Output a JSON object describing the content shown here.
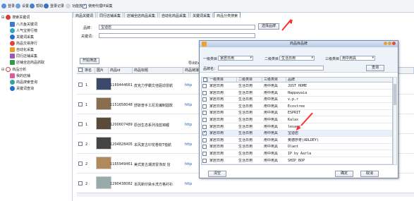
{
  "topbar": {
    "items": [
      "登录",
      "设置",
      "帮助",
      "登录记录",
      "功能放大"
    ],
    "checkbox_label": "使用代理IP采集"
  },
  "tabs": [
    "商品关键词",
    "同行店铺采集",
    "店铺全店商品采集",
    "自动化商品采集",
    "关键词采集",
    "商品分类搜索"
  ],
  "sidebar": {
    "group1": "搜索关键词",
    "items1": [
      "八爪鱼关键词",
      "人气宝排行榜",
      "关键词采集",
      "商品交易排行",
      "自动化采集",
      "同行店铺采集",
      "店铺全店商品抓取"
    ],
    "group2": "商品分析",
    "items2": [
      "我的店铺",
      "商品搜索查询",
      "关键词查询"
    ]
  },
  "form": {
    "brand_label": "品牌：",
    "brand_value": "宝迪岩",
    "keyword_label": "关键词：",
    "select_brand_button": "选择品牌",
    "start_button": "开始筛选",
    "export_button": "导出Excel"
  },
  "grid": {
    "headers": [
      "",
      "排名",
      "图片",
      "商品id",
      "商品标题",
      "商品链接",
      "商"
    ],
    "rows": [
      {
        "rank": "1",
        "id": "11694446617",
        "title": "皮克力学霸文他驱动冒航",
        "link": "http"
      },
      {
        "rank": "1",
        "id": "11516580481",
        "title": "舒斯普手工尼龙编制圆款",
        "link": "http"
      },
      {
        "rank": "1",
        "id": "12006074895",
        "title": "原创生态系列浅蓝锦鲤",
        "link": "http"
      },
      {
        "rank": "2",
        "id": "12048284051",
        "title": "本风复古印花卷软T恤航",
        "link": "http"
      },
      {
        "rank": "2",
        "id": "11659494612",
        "title": "美式复古潮流冒涤双 信",
        "link": "http"
      },
      {
        "rank": "2",
        "id": "12904380826",
        "title": "本风新印染水洗方格衬衫",
        "link": "http"
      }
    ]
  },
  "dialog": {
    "title": "商品库品牌",
    "cat1_label": "一级类目：",
    "cat1_value": "家居日用",
    "cat2_label": "二级类目：",
    "cat2_value": "生活日用",
    "cat3_label": "三级类目：",
    "cat3_value": "用中用具",
    "brand_label": "品牌名：",
    "search_button": "查询",
    "headers": [
      "",
      "一级类目",
      "二级类目",
      "三级类目",
      "品牌"
    ],
    "rows": [
      {
        "checked": false,
        "c1": "家居日用",
        "c2": "生活日用",
        "c3": "用中用具",
        "brand": "JUST HOME"
      },
      {
        "checked": false,
        "c1": "家居日用",
        "c2": "生活日用",
        "c3": "用中用具",
        "brand": "Happavaia"
      },
      {
        "checked": false,
        "c1": "家居日用",
        "c2": "生活日用",
        "c3": "用中用具",
        "brand": "v.p.r"
      },
      {
        "checked": false,
        "c1": "家居日用",
        "c2": "生活日用",
        "c3": "用中用具",
        "brand": "Ecostree"
      },
      {
        "checked": false,
        "c1": "家居日用",
        "c2": "生活日用",
        "c3": "用中用具",
        "brand": "ESPRIT"
      },
      {
        "checked": false,
        "c1": "家居日用",
        "c2": "生活日用",
        "c3": "用中用具",
        "brand": "Kalax"
      },
      {
        "checked": false,
        "c1": "家居日用",
        "c2": "生活日用",
        "c3": "用中用具",
        "brand": "lesace"
      },
      {
        "checked": true,
        "c1": "家居日用",
        "c2": "生活日用",
        "c3": "用中用具",
        "brand": "宝迪岩"
      },
      {
        "checked": false,
        "c1": "家居日用",
        "c2": "生活日用",
        "c3": "用中用具",
        "brand": "奥德彦奇(ADLDEY)"
      },
      {
        "checked": false,
        "c1": "家居日用",
        "c2": "生活日用",
        "c3": "用中用具",
        "brand": "Olant"
      },
      {
        "checked": false,
        "c1": "家居日用",
        "c2": "生活日用",
        "c3": "用中用具",
        "brand": "IP by Aarla"
      },
      {
        "checked": false,
        "c1": "家居日用",
        "c2": "生活日用",
        "c3": "用中用具",
        "brand": "SHIP BOP"
      }
    ],
    "clear_button": "清空",
    "ok_button": "确定",
    "cancel_button": "取消"
  },
  "colors": {
    "accent": "#1a56c0",
    "arrow": "#ff3030",
    "title_bar": "#b6c9e6"
  }
}
